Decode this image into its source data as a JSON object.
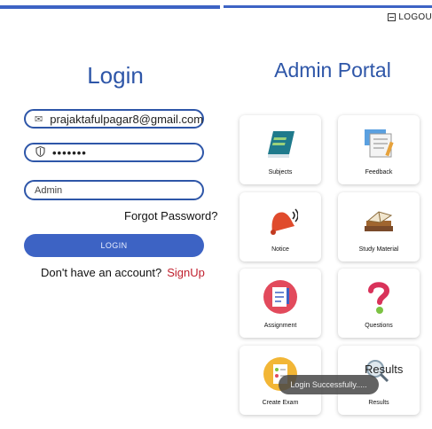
{
  "header": {
    "logout_label": "LOGOU"
  },
  "login": {
    "title": "Login",
    "email_value": "prajaktafulpagar8@gmail.com",
    "password_value": "•••••••",
    "role_value": "Admin",
    "forgot_label": "Forgot Password?",
    "login_button": "LOGIN",
    "no_account_text": "Don't have an account?",
    "signup_link": "SignUp"
  },
  "portal": {
    "title": "Admin Portal",
    "cards": [
      {
        "label": "Subjects",
        "icon": "book-icon"
      },
      {
        "label": "Feedback",
        "icon": "feedback-icon"
      },
      {
        "label": "Notice",
        "icon": "bell-icon"
      },
      {
        "label": "Study Material",
        "icon": "books-icon"
      },
      {
        "label": "Assignment",
        "icon": "clipboard-icon"
      },
      {
        "label": "Questions",
        "icon": "question-icon"
      },
      {
        "label": "Create Exam",
        "icon": "exam-icon"
      },
      {
        "label": "Results",
        "icon": "results-icon"
      }
    ],
    "results_overlay_text": "Results"
  },
  "toast": {
    "message": "Login Successfully....."
  },
  "colors": {
    "accent": "#3d63c4",
    "title": "#2e56a8",
    "signup": "#c0202e"
  }
}
